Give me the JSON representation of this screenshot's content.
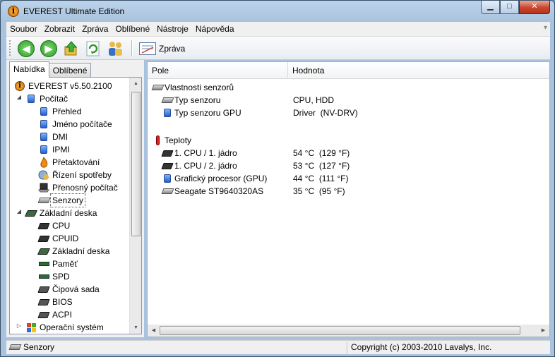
{
  "window": {
    "title": "EVEREST Ultimate Edition",
    "controls": {
      "minimize": "▁",
      "maximize": "□",
      "close": "✕"
    }
  },
  "menu": [
    "Soubor",
    "Zobrazit",
    "Zpráva",
    "Oblíbené",
    "Nástroje",
    "Nápověda"
  ],
  "toolbar": {
    "buttons": [
      {
        "name": "back",
        "icon": "arrow-left-icon",
        "glyph": "◀",
        "color": "#33a532"
      },
      {
        "name": "forward",
        "icon": "arrow-right-icon",
        "glyph": "▶",
        "color": "#33a532"
      },
      {
        "name": "up",
        "icon": "folder-up-icon",
        "glyph": "⬆",
        "color": "#e0a020"
      },
      {
        "name": "refresh",
        "icon": "refresh-icon",
        "glyph": "↻",
        "color": "#2e9a2e"
      },
      {
        "name": "users",
        "icon": "users-icon",
        "glyph": "👥",
        "color": "#3a6fc8"
      }
    ],
    "report_label": "Zpráva"
  },
  "left_panel": {
    "tabs": [
      "Nabídka",
      "Oblíbené"
    ],
    "active_tab": "Nabídka",
    "tree": [
      {
        "label": "EVEREST v5.50.2100",
        "level": 0,
        "icon": "everest-info-icon"
      },
      {
        "label": "Počítač",
        "level": 1,
        "icon": "computer-icon",
        "expander": "◢"
      },
      {
        "label": "Přehled",
        "level": 2,
        "icon": "computer-icon"
      },
      {
        "label": "Jméno počítače",
        "level": 2,
        "icon": "computer-icon"
      },
      {
        "label": "DMI",
        "level": 2,
        "icon": "computer-icon"
      },
      {
        "label": "IPMI",
        "level": 2,
        "icon": "computer-icon"
      },
      {
        "label": "Přetaktování",
        "level": 2,
        "icon": "flame-icon"
      },
      {
        "label": "Řízení spotřeby",
        "level": 2,
        "icon": "power-management-icon"
      },
      {
        "label": "Přenosný počítač",
        "level": 2,
        "icon": "laptop-icon"
      },
      {
        "label": "Senzory",
        "level": 2,
        "icon": "sensor-icon",
        "selected": true
      },
      {
        "label": "Základní deska",
        "level": 1,
        "icon": "motherboard-icon",
        "expander": "◢"
      },
      {
        "label": "CPU",
        "level": 2,
        "icon": "cpu-icon"
      },
      {
        "label": "CPUID",
        "level": 2,
        "icon": "cpu-icon"
      },
      {
        "label": "Základní deska",
        "level": 2,
        "icon": "motherboard-icon"
      },
      {
        "label": "Paměť",
        "level": 2,
        "icon": "memory-icon"
      },
      {
        "label": "SPD",
        "level": 2,
        "icon": "memory-icon"
      },
      {
        "label": "Čipová sada",
        "level": 2,
        "icon": "chipset-icon"
      },
      {
        "label": "BIOS",
        "level": 2,
        "icon": "bios-icon"
      },
      {
        "label": "ACPI",
        "level": 2,
        "icon": "acpi-icon"
      },
      {
        "label": "Operační systém",
        "level": 1,
        "icon": "windows-icon",
        "expander": "▷"
      }
    ]
  },
  "right_panel": {
    "columns": [
      "Pole",
      "Hodnota"
    ],
    "rows": [
      {
        "field": "Vlastnosti senzorů",
        "value": "",
        "indent": 0,
        "icon": "sensor-icon"
      },
      {
        "field": "Typ senzoru",
        "value": "CPU, HDD",
        "indent": 1,
        "icon": "sensor-icon"
      },
      {
        "field": "Typ senzoru GPU",
        "value": "Driver  (NV-DRV)",
        "indent": 1,
        "icon": "monitor-icon"
      },
      {
        "field": "Teploty",
        "value": "",
        "indent": 0,
        "icon": "thermometer-icon"
      },
      {
        "field": "1. CPU / 1. jádro",
        "value": "54 °C  (129 °F)",
        "indent": 1,
        "icon": "cpu-icon"
      },
      {
        "field": "1. CPU / 2. jádro",
        "value": "53 °C  (127 °F)",
        "indent": 1,
        "icon": "cpu-icon"
      },
      {
        "field": "Grafický procesor (GPU)",
        "value": "44 °C  (111 °F)",
        "indent": 1,
        "icon": "monitor-icon"
      },
      {
        "field": "Seagate ST9640320AS",
        "value": "35 °C  (95 °F)",
        "indent": 1,
        "icon": "hard-disk-icon"
      }
    ]
  },
  "status_bar": {
    "left": "Senzory",
    "right": "Copyright (c) 2003-2010 Lavalys, Inc."
  }
}
